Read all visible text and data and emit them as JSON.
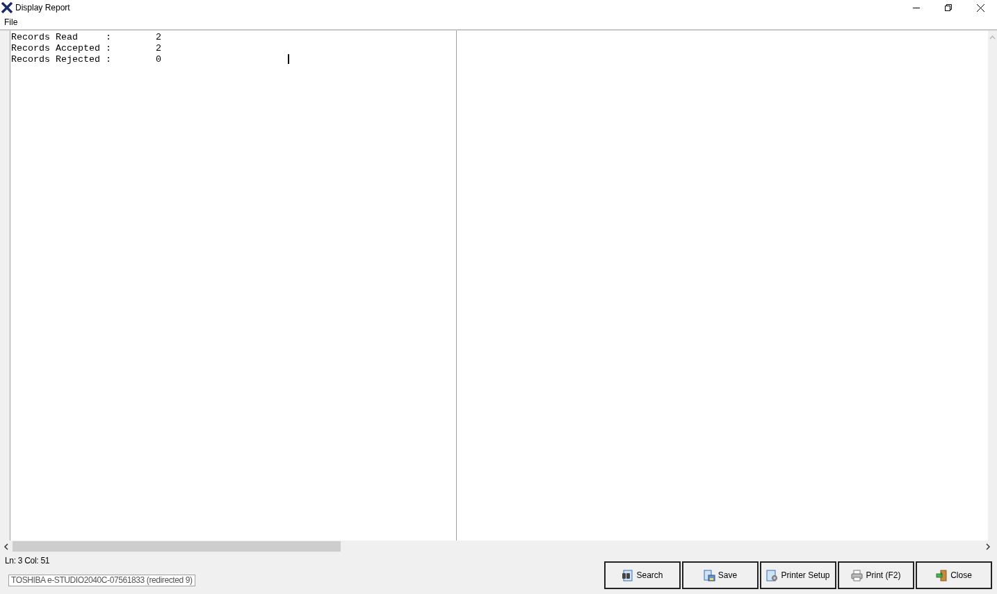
{
  "window": {
    "title": "Display Report"
  },
  "menu": [
    "File"
  ],
  "report": {
    "lines": [
      "Records Read     :        2",
      "Records Accepted :        2",
      "Records Rejected :        0"
    ]
  },
  "status": {
    "position": "Ln: 3 Col: 51",
    "printer": "TOSHIBA e-STUDIO2040C-07561833 (redirected 9)"
  },
  "buttons": [
    {
      "label": "Search",
      "kind": "search"
    },
    {
      "label": "Save",
      "kind": "save"
    },
    {
      "label": "Printer Setup",
      "kind": "setup"
    },
    {
      "label": "Print (F2)",
      "kind": "print"
    },
    {
      "label": "Close",
      "kind": "close"
    }
  ]
}
